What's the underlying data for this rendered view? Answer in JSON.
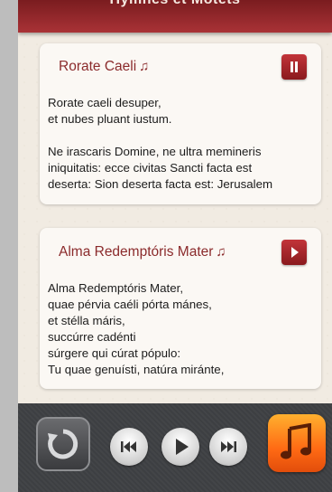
{
  "header": {
    "title": "Hymnes et Motets"
  },
  "hymns": [
    {
      "title": "Rorate Caeli",
      "state": "playing",
      "lyrics": "Rorate caeli desuper,\net nubes pluant iustum.\n\nNe irascaris Domine, ne ultra memineris\niniquitatis: ecce civitas Sancti facta est\ndeserta: Sion deserta facta est: Jerusalem"
    },
    {
      "title": "Alma Redemptóris Mater",
      "state": "paused",
      "lyrics": "Alma Redemptóris Mater,\nquae pérvia caéli pórta mánes,\net stélla máris,\nsuccúrre cadénti\nsúrgere qui cúrat pópulo:\nTu quae genuísti, natúra miránte,"
    }
  ],
  "icons": {
    "hymn_note": "♫",
    "pause": "pause-icon",
    "play": "play-icon",
    "repeat": "repeat-icon",
    "previous": "previous-icon",
    "next": "next-icon",
    "music": "music-note-icon"
  },
  "colors": {
    "accent": "#8b2b2c",
    "header": "#9a2a2e",
    "card_bg": "#fbf8f4",
    "footer_bg": "#3d3f42",
    "music_button": "#ff7a1a"
  }
}
